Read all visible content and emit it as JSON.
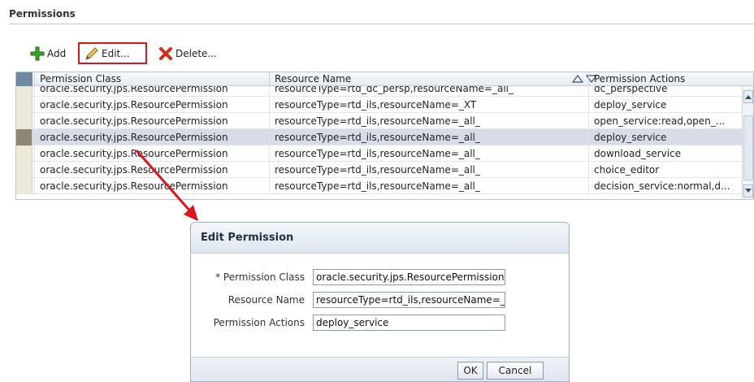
{
  "section": {
    "title": "Permissions"
  },
  "toolbar": {
    "add_label": "Add",
    "edit_label": "Edit...",
    "delete_label": "Delete..."
  },
  "grid": {
    "columns": [
      "Permission Class",
      "Resource Name",
      "Permission Actions"
    ],
    "rows": [
      {
        "class": "oracle.security.jps.ResourcePermission",
        "resource": "resourceType=rtd_dc_persp,resourceName=_all_",
        "actions": "dc_perspective",
        "selected": false
      },
      {
        "class": "oracle.security.jps.ResourcePermission",
        "resource": "resourceType=rtd_ils,resourceName=_XT",
        "actions": "deploy_service",
        "selected": false
      },
      {
        "class": "oracle.security.jps.ResourcePermission",
        "resource": "resourceType=rtd_ils,resourceName=_all_",
        "actions": "open_service:read,open_...",
        "selected": false
      },
      {
        "class": "oracle.security.jps.ResourcePermission",
        "resource": "resourceType=rtd_ils,resourceName=_all_",
        "actions": "deploy_service",
        "selected": true
      },
      {
        "class": "oracle.security.jps.ResourcePermission",
        "resource": "resourceType=rtd_ils,resourceName=_all_",
        "actions": "download_service",
        "selected": false
      },
      {
        "class": "oracle.security.jps.ResourcePermission",
        "resource": "resourceType=rtd_ils,resourceName=_all_",
        "actions": "choice_editor",
        "selected": false
      },
      {
        "class": "oracle.security.jps.ResourcePermission",
        "resource": "resourceType=rtd_ils,resourceName=_all_",
        "actions": "decision_service:normal,d...",
        "selected": false
      }
    ]
  },
  "dialog": {
    "title": "Edit Permission",
    "fields": [
      {
        "label": "* Permission Class",
        "value": "oracle.security.jps.ResourcePermission"
      },
      {
        "label": "Resource Name",
        "value": "resourceType=rtd_ils,resourceName=_all_"
      },
      {
        "label": "Permission Actions",
        "value": "deploy_service"
      }
    ],
    "ok_label": "OK",
    "cancel_label": "Cancel"
  },
  "colors": {
    "highlight": "#e0141b",
    "selected_row": "#d6dde6",
    "header_accent": "#6e8aa3"
  },
  "icons": {
    "add": "plus-icon",
    "edit": "pencil-icon",
    "delete": "x-icon"
  }
}
